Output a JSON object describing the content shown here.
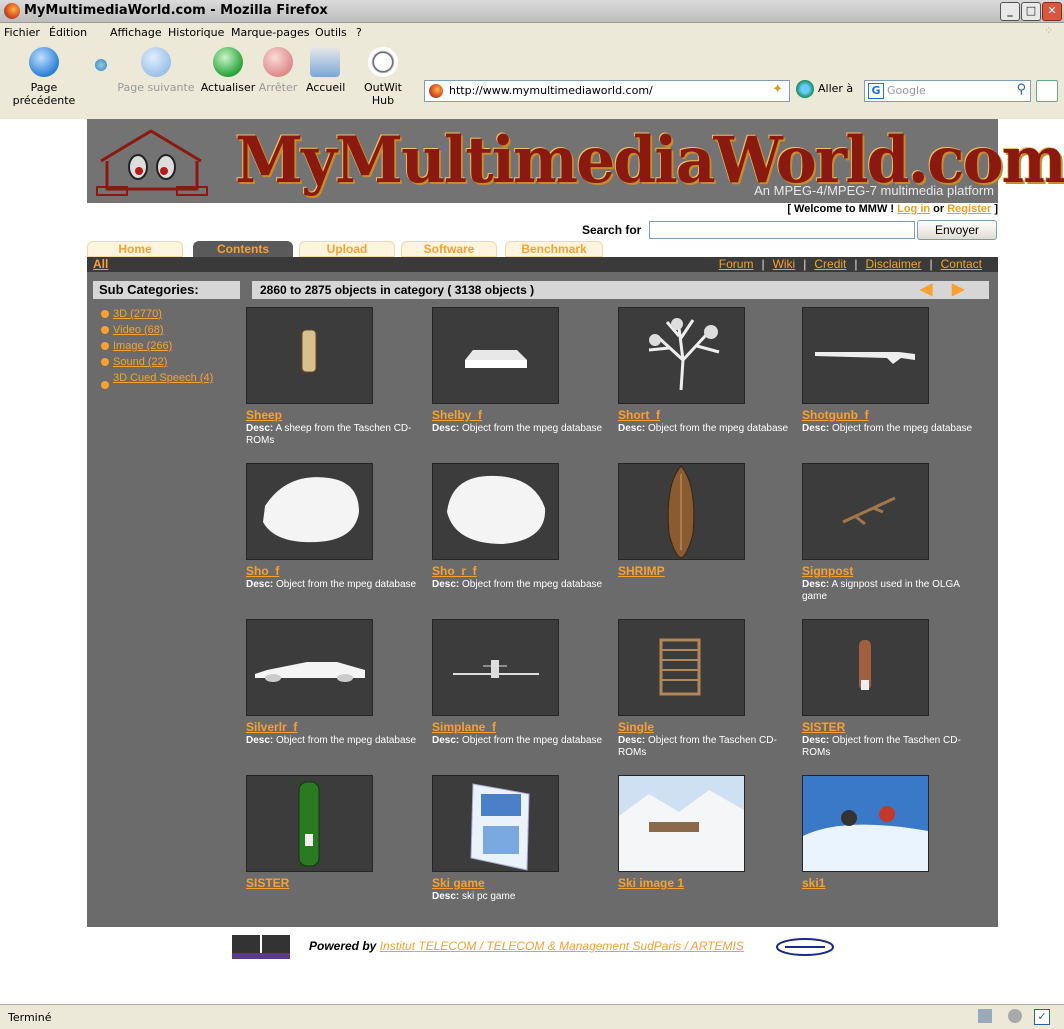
{
  "window": {
    "title": "MyMultimediaWorld.com - Mozilla Firefox"
  },
  "menu": [
    "Fichier",
    "Édition",
    "Affichage",
    "Historique",
    "Marque-pages",
    "Outils",
    "?"
  ],
  "nav": {
    "back": "Page précédente",
    "forward": "Page suivante",
    "reload": "Actualiser",
    "stop": "Arrêter",
    "home": "Accueil",
    "outwit": "OutWit Hub",
    "url": "http://www.mymultimediaworld.com/",
    "go": "Aller à",
    "search_placeholder": "Google"
  },
  "status": "Terminé",
  "site": {
    "title": "MyMultimediaWorld.com",
    "tagline": "An MPEG-4/MPEG-7 multimedia platform",
    "welcome_pre": "[ Welcome to MMW ! ",
    "login": "Log in",
    "or": " or ",
    "register": "Register",
    "welcome_post": " ]",
    "search_label": "Search for",
    "search_button": "Envoyer",
    "tabs": [
      "Home",
      "Contents",
      "Upload",
      "Software",
      "Benchmark"
    ],
    "all": "All",
    "top_links": [
      "Forum",
      "Wiki",
      "Credit",
      "Disclaimer",
      "Contact"
    ],
    "sub_categories": "Sub Categories:",
    "categories": [
      "3D (2770)",
      "Video (68)",
      "Image (266)",
      "Sound (22)",
      "3D Cued Speech (4)"
    ],
    "results": "2860 to 2875 objects in category ( 3138 objects )",
    "desc_label": "Desc:",
    "items": [
      {
        "name": "Sheep",
        "desc": " A sheep from the Taschen CD-ROMs"
      },
      {
        "name": "Shelby_f",
        "desc": " Object from the mpeg database"
      },
      {
        "name": "Short_f",
        "desc": " Object from the mpeg database"
      },
      {
        "name": "Shotgunb_f",
        "desc": " Object from the mpeg database"
      },
      {
        "name": "Sho_f",
        "desc": " Object from the mpeg database"
      },
      {
        "name": "Sho_r_f",
        "desc": " Object from the mpeg database"
      },
      {
        "name": "SHRIMP",
        "desc": ""
      },
      {
        "name": "Signpost",
        "desc": " A signpost used in the OLGA game"
      },
      {
        "name": "Silverlr_f",
        "desc": " Object from the mpeg database"
      },
      {
        "name": "Simplane_f",
        "desc": " Object from the mpeg database"
      },
      {
        "name": "Single",
        "desc": " Object from the Taschen CD-ROMs"
      },
      {
        "name": "SISTER",
        "desc": " Object from the Taschen CD-ROMs"
      },
      {
        "name": "SISTER",
        "desc": ""
      },
      {
        "name": "Ski game",
        "desc": " ski pc game"
      },
      {
        "name": "Ski image 1",
        "desc": ""
      },
      {
        "name": "ski1",
        "desc": ""
      }
    ],
    "powered_by": "Powered by ",
    "powered_link": "Institut TELECOM / TELECOM & Management SudParis / ARTEMIS",
    "colors": {
      "accent": "#f8a030",
      "panel": "#6b6b6b",
      "title_red": "#8a1a10"
    }
  }
}
